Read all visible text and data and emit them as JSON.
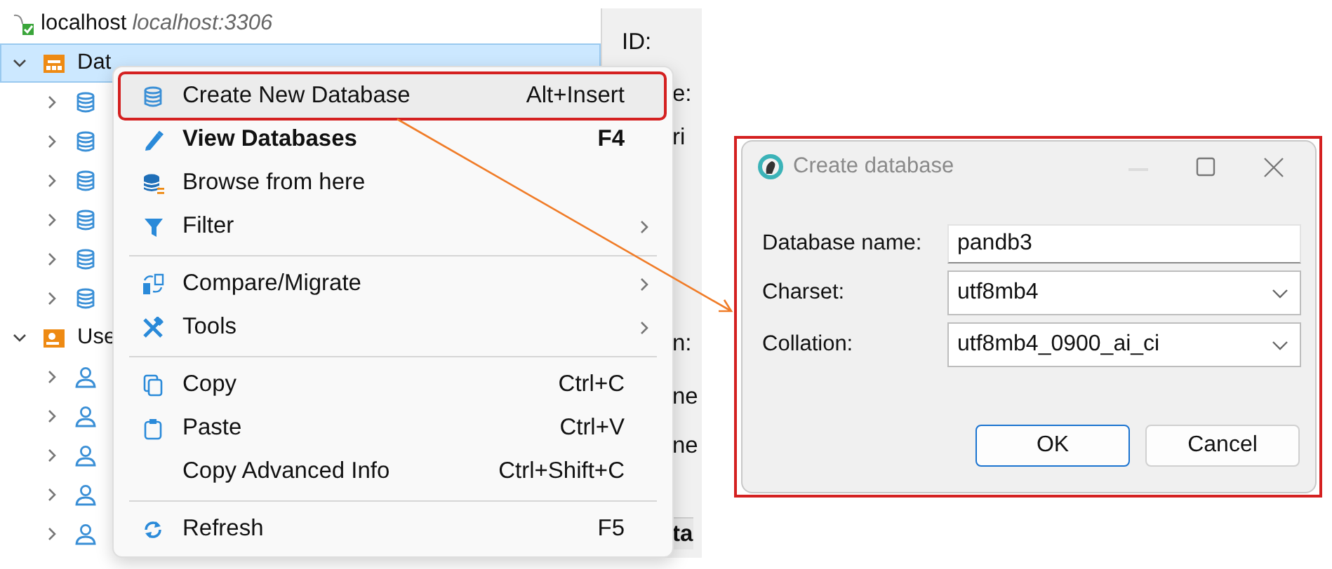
{
  "tree": {
    "kind": "connection",
    "label": "localhost",
    "detail": "localhost:3306",
    "children": [
      {
        "kind": "catalog",
        "label": "Dat",
        "expanded": true,
        "selected": true,
        "children": [
          {
            "kind": "database",
            "expanded": false,
            "selected": false
          },
          {
            "kind": "database",
            "expanded": false,
            "selected": false
          },
          {
            "kind": "database",
            "expanded": false,
            "selected": false
          },
          {
            "kind": "database",
            "expanded": false,
            "selected": false
          },
          {
            "kind": "database",
            "expanded": false,
            "selected": false
          },
          {
            "kind": "database",
            "expanded": false,
            "selected": false
          }
        ]
      },
      {
        "kind": "userlist",
        "label": "Use",
        "expanded": true,
        "selected": false,
        "children": [
          {
            "kind": "user",
            "expanded": false,
            "selected": false
          },
          {
            "kind": "user",
            "expanded": false,
            "selected": false
          },
          {
            "kind": "user",
            "expanded": false,
            "selected": false
          },
          {
            "kind": "user",
            "expanded": false,
            "selected": false
          },
          {
            "kind": "user",
            "expanded": false,
            "selected": false
          }
        ]
      }
    ]
  },
  "properties": [
    {
      "kind": "label",
      "text": "ID:"
    },
    {
      "kind": "label",
      "text": "e:"
    },
    {
      "kind": "label",
      "text": "ri"
    },
    {
      "kind": "label",
      "text": "n:"
    },
    {
      "kind": "label",
      "text": "ne"
    },
    {
      "kind": "label",
      "text": "ne"
    },
    {
      "kind": "header",
      "text": "ta"
    }
  ],
  "menu": {
    "items": [
      {
        "kind": "item",
        "label": "Create New Database",
        "shortcut": "Alt+Insert",
        "bold": false,
        "submenu": false,
        "highlighted": true
      },
      {
        "kind": "item",
        "label": "View Databases",
        "shortcut": "F4",
        "bold": true,
        "submenu": false,
        "highlighted": false
      },
      {
        "kind": "item",
        "label": "Browse from here",
        "bold": false,
        "submenu": false,
        "highlighted": false
      },
      {
        "kind": "item",
        "label": "Filter",
        "bold": false,
        "submenu": true,
        "highlighted": false
      },
      {
        "kind": "separator"
      },
      {
        "kind": "item",
        "label": "Compare/Migrate",
        "bold": false,
        "submenu": true,
        "highlighted": false
      },
      {
        "kind": "item",
        "label": "Tools",
        "bold": false,
        "submenu": true,
        "highlighted": false
      },
      {
        "kind": "separator"
      },
      {
        "kind": "item",
        "label": "Copy",
        "shortcut": "Ctrl+C",
        "bold": false,
        "submenu": false,
        "highlighted": false
      },
      {
        "kind": "item",
        "label": "Paste",
        "shortcut": "Ctrl+V",
        "bold": false,
        "submenu": false,
        "highlighted": false
      },
      {
        "kind": "item",
        "label": "Copy Advanced Info",
        "shortcut": "Ctrl+Shift+C",
        "bold": false,
        "submenu": false,
        "highlighted": false
      },
      {
        "kind": "separator"
      },
      {
        "kind": "item",
        "label": "Refresh",
        "shortcut": "F5",
        "bold": false,
        "submenu": false,
        "highlighted": false
      }
    ]
  },
  "annotation_arrow": true,
  "dialog": {
    "title": "Create database",
    "annotated": true,
    "fields": [
      {
        "kind": "text",
        "label": "Database name:",
        "value": "pandb3"
      },
      {
        "kind": "select",
        "label": "Charset:",
        "value": "utf8mb4"
      },
      {
        "kind": "select",
        "label": "Collation:",
        "value": "utf8mb4_0900_ai_ci"
      }
    ],
    "buttons": [
      {
        "label": "OK",
        "default": true
      },
      {
        "label": "Cancel",
        "default": false
      }
    ]
  }
}
